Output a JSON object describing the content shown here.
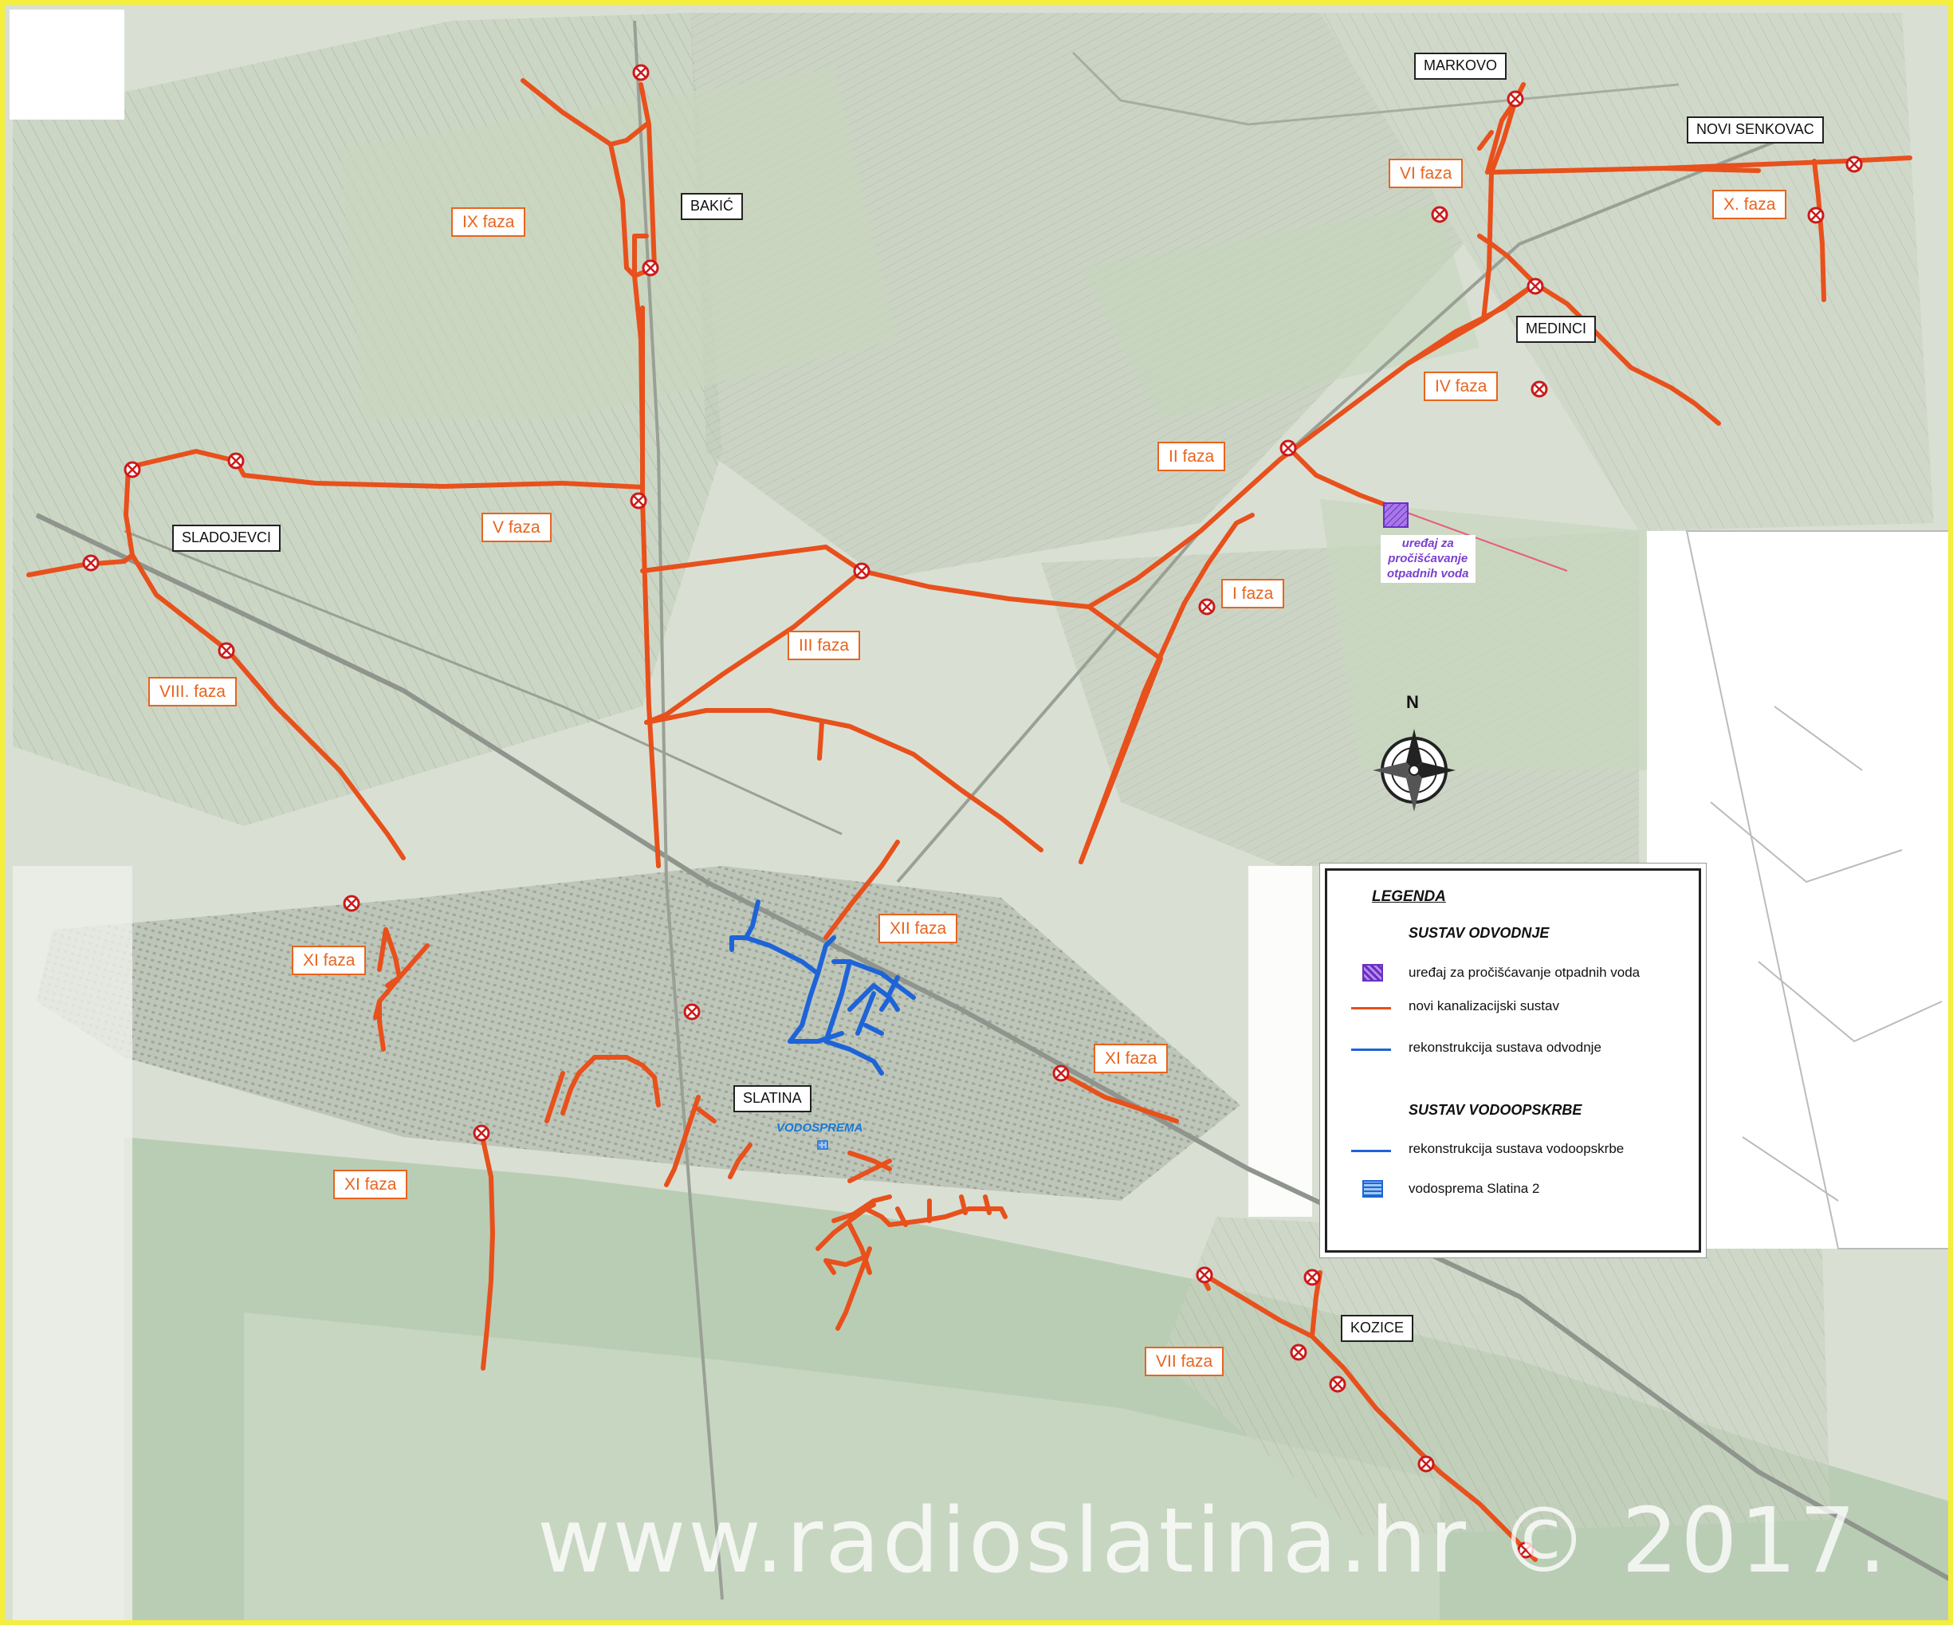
{
  "map": {
    "colors": {
      "sewer_new": "#e8501c",
      "water_reconstruction": "#1e64d8",
      "frame": "#f4ee3c",
      "plant_fill": "#8a4fd8"
    }
  },
  "phases": {
    "p1": "I faza",
    "p2": "II faza",
    "p3": "III faza",
    "p4": "IV faza",
    "p5": "V faza",
    "p6": "VI faza",
    "p7": "VII faza",
    "p8": "VIII. faza",
    "p9": "IX faza",
    "p10": "X.  faza",
    "p11": "XI  faza",
    "p12": "XII faza"
  },
  "places": {
    "markovo": "MARKOVO",
    "novi_senkovac": "NOVI SENKOVAC",
    "bakic": "BAKIĆ",
    "medinci": "MEDINCI",
    "sladojevci": "SLADOJEVCI",
    "slatina": "SLATINA",
    "kozice": "KOZICE"
  },
  "plant_label": "uređaj za\npročišćavanje\notpadnih voda",
  "water_tank_label": "VODOSPREMA",
  "north_letter": "N",
  "legend": {
    "title": "LEGENDA",
    "section_sewer": "SUSTAV ODVODNJE",
    "plant": "uređaj za pročišćavanje otpadnih voda",
    "new_sewer": "novi kanalizacijski sustav",
    "sewer_reconstruction": "rekonstrukcija sustava odvodnje",
    "section_water": "SUSTAV VODOOPSKRBE",
    "water_reconstruction": "rekonstrukcija sustava vodoopskrbe",
    "water_tank": "vodosprema Slatina 2"
  },
  "watermark": "www.radioslatina.hr © 2017."
}
